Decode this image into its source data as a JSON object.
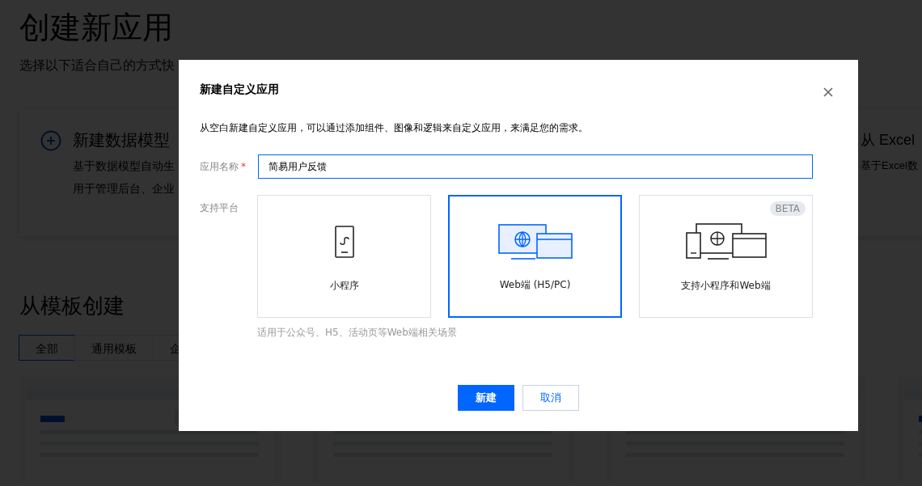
{
  "page": {
    "title": "创建新应用",
    "subtitle": "选择以下适合自己的方式快",
    "cards": [
      {
        "kind": "blank",
        "title": "新建数据模型",
        "lines": [
          "基于数据模型自动生",
          "用于管理后台、企业"
        ]
      },
      {
        "kind": "excel",
        "title": "从 Excel",
        "lines": [
          "基于Excel数"
        ]
      }
    ],
    "section_title": "从模板创建",
    "tabs": [
      {
        "label": "全部",
        "selected": true
      },
      {
        "label": "通用模板",
        "selected": false
      },
      {
        "label": "企",
        "selected": false
      }
    ]
  },
  "dialog": {
    "title": "新建自定义应用",
    "description": "从空白新建自定义应用，可以通过添加组件、图像和逻辑来自定义应用，来满足您的需求。",
    "name_label": "应用名称",
    "required_mark": "*",
    "name_value": "简易用户反馈",
    "platform_label": "支持平台",
    "options": [
      {
        "kind": "mini",
        "label": "小程序",
        "selected": false
      },
      {
        "kind": "web",
        "label": "Web端 (H5/PC)",
        "selected": true
      },
      {
        "kind": "both",
        "label": "支持小程序和Web端",
        "selected": false,
        "badge": "BETA"
      }
    ],
    "hint": "适用于公众号、H5、活动页等Web端相关场景",
    "buttons": [
      {
        "kind": "primary",
        "label": "新建"
      },
      {
        "kind": "secondary",
        "label": "取消"
      }
    ]
  }
}
